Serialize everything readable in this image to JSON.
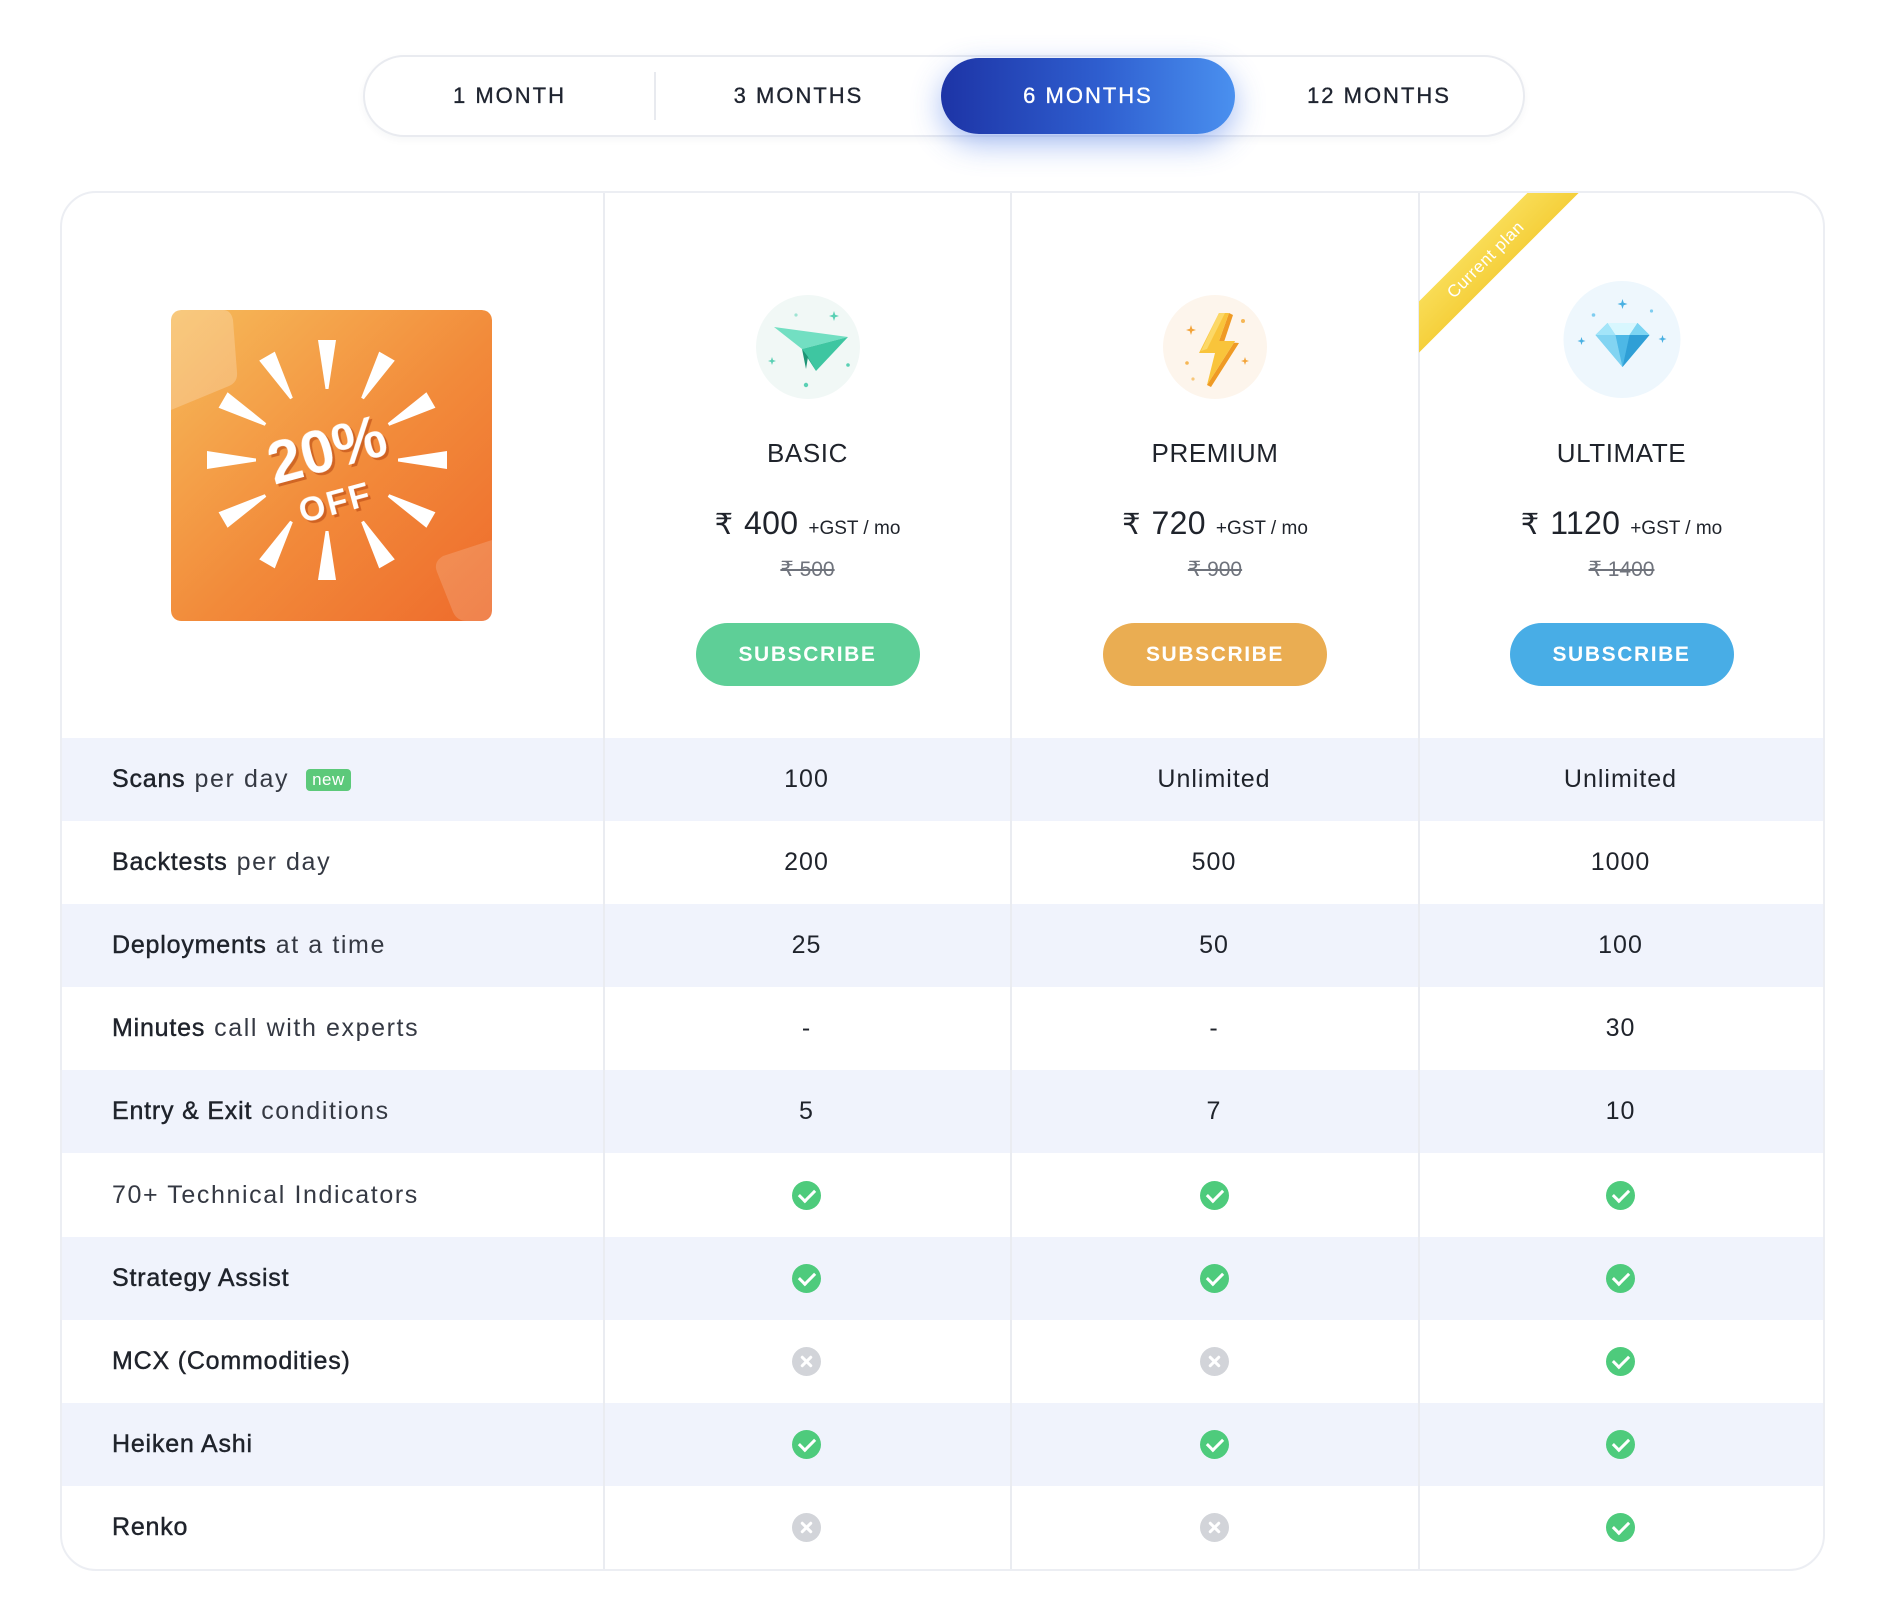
{
  "tabs": [
    {
      "label": "1 MONTH",
      "active": false
    },
    {
      "label": "3 MONTHS",
      "active": false
    },
    {
      "label": "6 MONTHS",
      "active": true
    },
    {
      "label": "12 MONTHS",
      "active": false
    }
  ],
  "promo": {
    "headline": "20%",
    "subline": "OFF",
    "icon": "discount-badge-icon"
  },
  "current_plan_label": "Current plan",
  "plans": [
    {
      "name": "BASIC",
      "currency": "₹",
      "price": "400",
      "price_suffix": "+GST / mo",
      "original_price": "₹ 500",
      "cta": "SUBSCRIBE",
      "color": "#5ecf97",
      "icon": "paper-plane-icon"
    },
    {
      "name": "PREMIUM",
      "currency": "₹",
      "price": "720",
      "price_suffix": "+GST / mo",
      "original_price": "₹ 900",
      "cta": "SUBSCRIBE",
      "color": "#eaad52",
      "icon": "lightning-bolt-icon"
    },
    {
      "name": "ULTIMATE",
      "currency": "₹",
      "price": "1120",
      "price_suffix": "+GST / mo",
      "original_price": "₹ 1400",
      "cta": "SUBSCRIBE",
      "color": "#48ade6",
      "icon": "diamond-icon",
      "current": true
    }
  ],
  "features": [
    {
      "label_strong": "Scans",
      "label_light": "per day",
      "badge": "new",
      "values": [
        "100",
        "Unlimited",
        "Unlimited"
      ]
    },
    {
      "label_strong": "Backtests",
      "label_light": "per day",
      "values": [
        "200",
        "500",
        "1000"
      ]
    },
    {
      "label_strong": "Deployments",
      "label_light": "at a time",
      "values": [
        "25",
        "50",
        "100"
      ]
    },
    {
      "label_strong": "Minutes",
      "label_light": "call with experts",
      "values": [
        "-",
        "-",
        "30"
      ]
    },
    {
      "label_strong": "Entry & Exit",
      "label_light": "conditions",
      "values": [
        "5",
        "7",
        "10"
      ]
    },
    {
      "label_light": "70+ Technical Indicators",
      "icons": [
        "check-icon",
        "check-icon",
        "check-icon"
      ]
    },
    {
      "label_strong": "Strategy Assist",
      "icons": [
        "check-icon",
        "check-icon",
        "check-icon"
      ]
    },
    {
      "label_strong": "MCX (Commodities)",
      "icons": [
        "cross-icon",
        "cross-icon",
        "check-icon"
      ]
    },
    {
      "label_strong": "Heiken Ashi",
      "icons": [
        "check-icon",
        "check-icon",
        "check-icon"
      ]
    },
    {
      "label_strong": "Renko",
      "icons": [
        "cross-icon",
        "cross-icon",
        "check-icon"
      ]
    }
  ],
  "colors": {
    "tab_active_from": "#1d34a6",
    "tab_active_to": "#4a90ef",
    "row_alt": "#f0f3fc",
    "check": "#4ecb7c",
    "cross": "#d2d4d9",
    "badge_new": "#5cc97a",
    "ribbon": "#f7d444",
    "promo_from": "#f6bb5a",
    "promo_to": "#ee6b2c"
  }
}
